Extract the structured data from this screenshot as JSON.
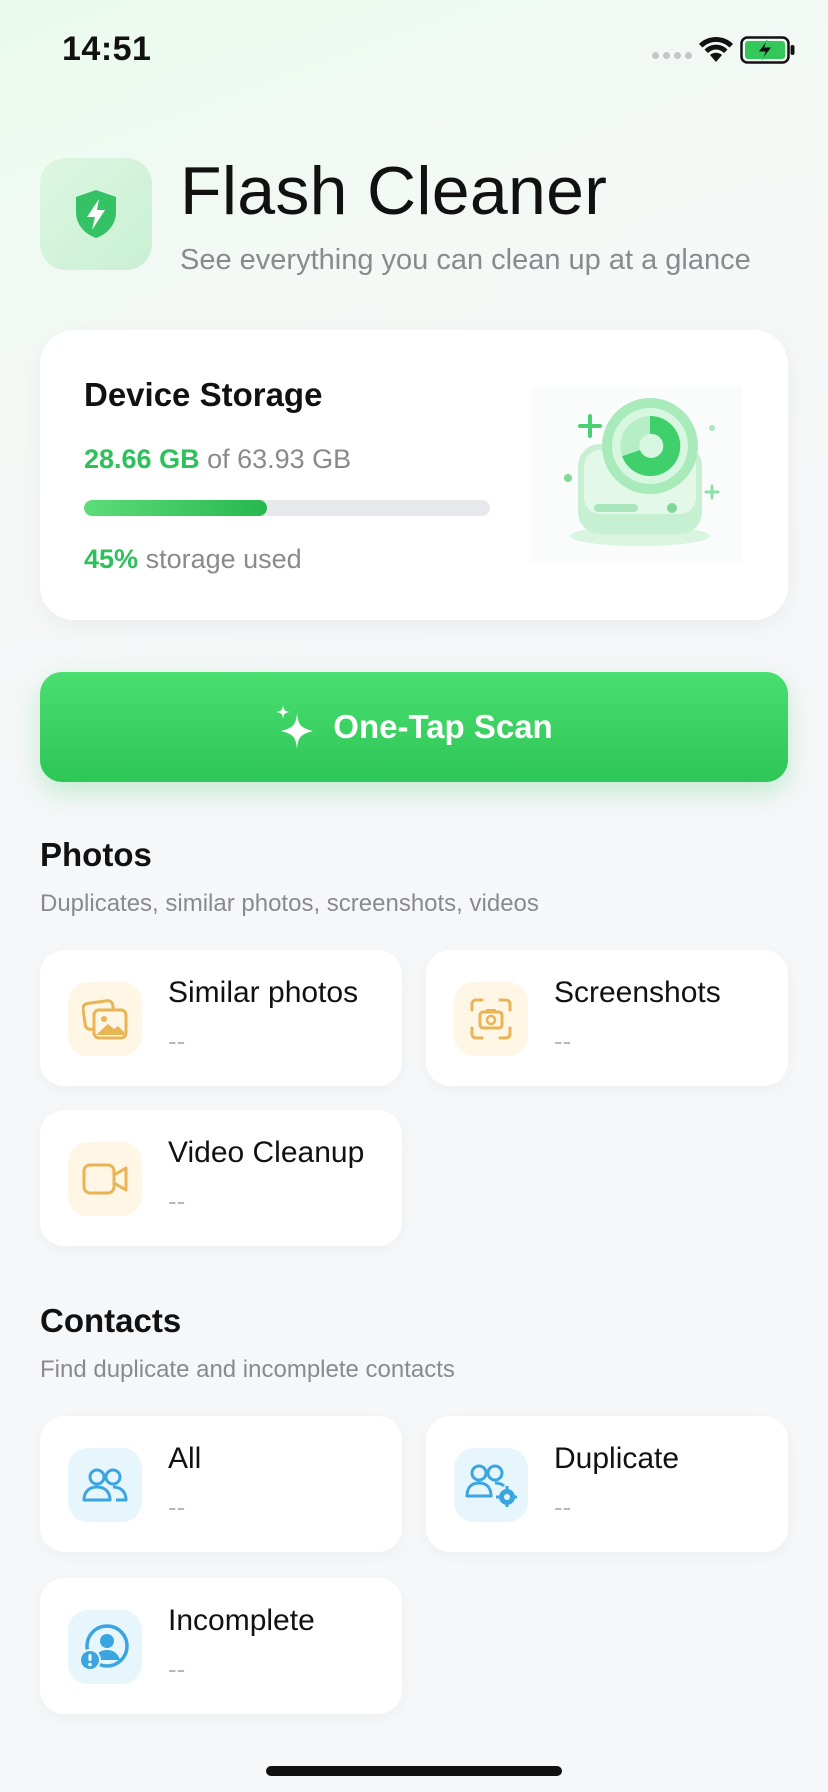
{
  "status_bar": {
    "time": "14:51"
  },
  "header": {
    "title": "Flash Cleaner",
    "subtitle": "See everything you can clean up at a glance",
    "icon": "shield-bolt-icon"
  },
  "storage": {
    "title": "Device Storage",
    "used": "28.66 GB",
    "total_text": "of 63.93 GB",
    "percent_label": "45%",
    "percent_suffix": "storage used",
    "percent_value": 0.45,
    "accent_color": "#2ec05a"
  },
  "scan_button": {
    "label": "One-Tap Scan",
    "icon": "sparkle-icon"
  },
  "photos": {
    "title": "Photos",
    "description": "Duplicates, similar photos, screenshots, videos",
    "items": [
      {
        "label": "Similar photos",
        "value": "--",
        "icon": "photos-icon"
      },
      {
        "label": "Screenshots",
        "value": "--",
        "icon": "screenshot-icon"
      },
      {
        "label": "Video Cleanup",
        "value": "--",
        "icon": "video-icon"
      }
    ]
  },
  "contacts": {
    "title": "Contacts",
    "description": "Find duplicate and incomplete contacts",
    "items": [
      {
        "label": "All",
        "value": "--",
        "icon": "contacts-icon"
      },
      {
        "label": "Duplicate",
        "value": "--",
        "icon": "duplicate-contacts-icon"
      },
      {
        "label": "Incomplete",
        "value": "--",
        "icon": "incomplete-contact-icon"
      }
    ]
  }
}
